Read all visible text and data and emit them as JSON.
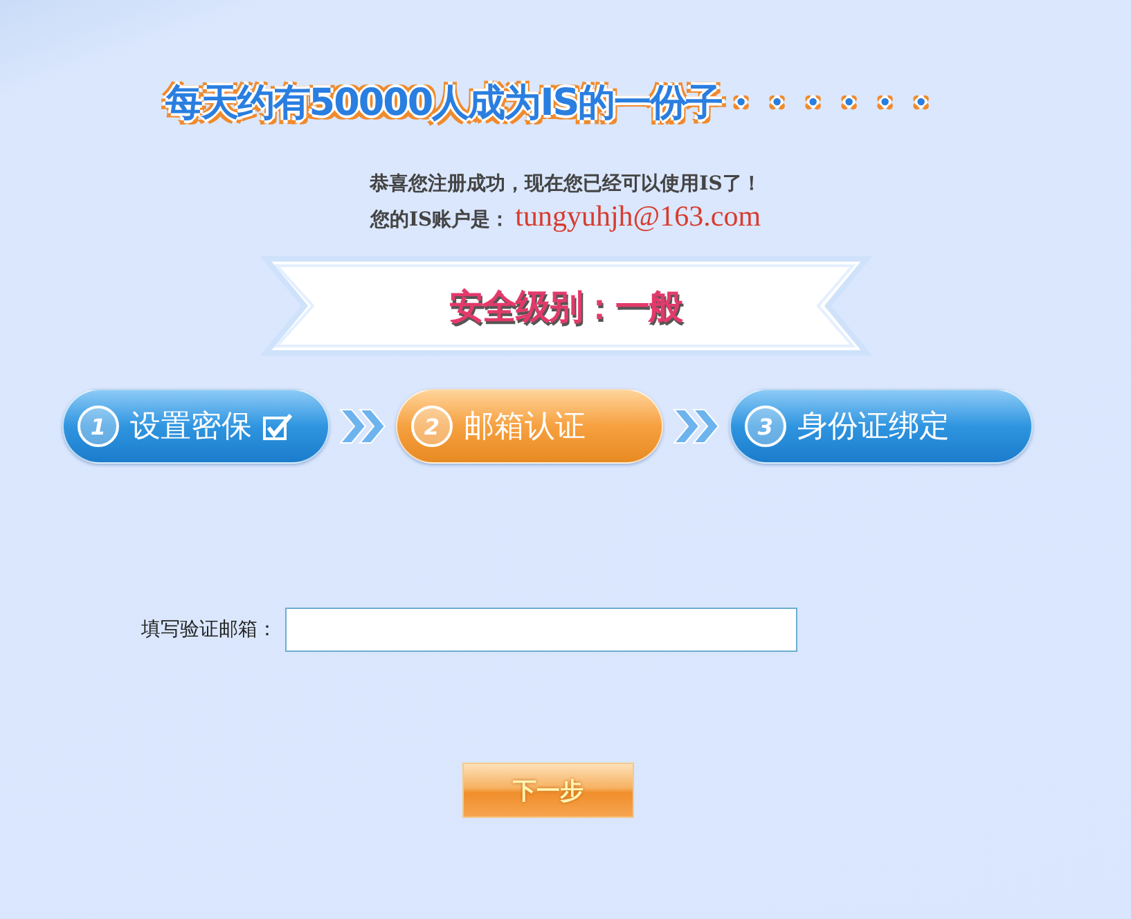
{
  "headline": "每天约有50000人成为IS的一份子・・・・・・",
  "message": {
    "line": "恭喜您注册成功，现在您已经可以使用IS了！",
    "account_label": "您的IS账户是：",
    "account": "tungyuhjh@163.com"
  },
  "security": {
    "label": "安全级别：一般"
  },
  "steps": [
    {
      "number": "1",
      "label": "设置密保",
      "done": true,
      "selected": false
    },
    {
      "number": "2",
      "label": "邮箱认证",
      "done": false,
      "selected": true
    },
    {
      "number": "3",
      "label": "身份证绑定",
      "done": false,
      "selected": false
    }
  ],
  "email_field": {
    "label": "填写验证邮箱："
  },
  "next_button": "下一步"
}
